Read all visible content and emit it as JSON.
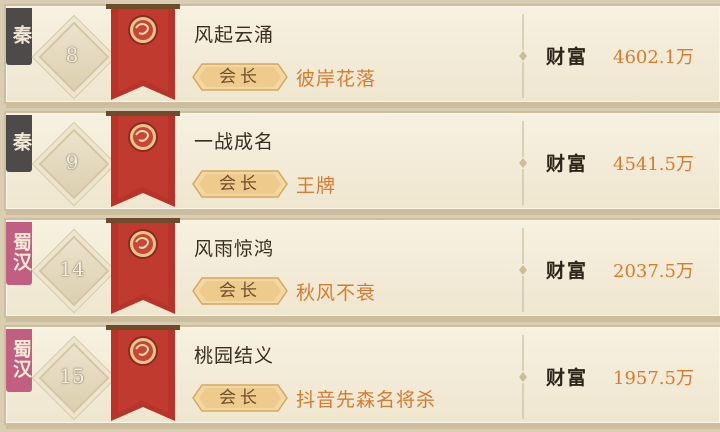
{
  "guild_list": {
    "wealth_label": "财富",
    "role_label": "会长",
    "rows": [
      {
        "faction": "秦",
        "faction_color": "#4f4a4a",
        "rank": "8",
        "guild_name": "风起云涌",
        "leader": "彼岸花落",
        "wealth": "4602.1万"
      },
      {
        "faction": "秦",
        "faction_color": "#4f4a4a",
        "rank": "9",
        "guild_name": "一战成名",
        "leader": "王牌",
        "wealth": "4541.5万"
      },
      {
        "faction": "蜀汉",
        "faction_color": "#c05f82",
        "rank": "14",
        "guild_name": "风雨惊鸿",
        "leader": "秋风不衰",
        "wealth": "2037.5万"
      },
      {
        "faction": "蜀汉",
        "faction_color": "#c05f82",
        "rank": "15",
        "guild_name": "桃园结义",
        "leader": "抖音先森名将杀",
        "wealth": "1957.5万"
      }
    ]
  },
  "icons": {
    "banner": "dragon-banner-icon",
    "rank_badge": "diamond-rank-icon"
  },
  "colors": {
    "accent": "#d97b2e",
    "banner_red": "#b8332a",
    "text_dark": "#3a2d22"
  }
}
